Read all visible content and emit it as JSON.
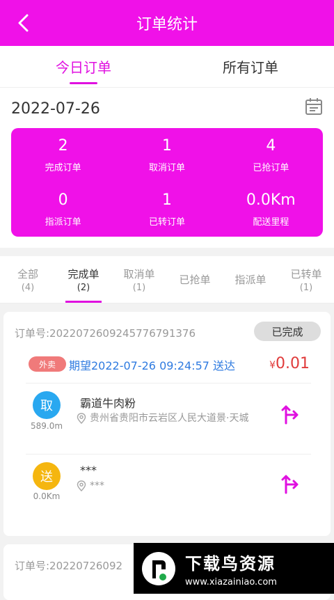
{
  "header": {
    "title": "订单统计"
  },
  "tabs": [
    {
      "label": "今日订单"
    },
    {
      "label": "所有订单"
    }
  ],
  "date": "2022-07-26",
  "stats": [
    {
      "value": "2",
      "label": "完成订单"
    },
    {
      "value": "1",
      "label": "取消订单"
    },
    {
      "value": "4",
      "label": "已抢订单"
    },
    {
      "value": "0",
      "label": "指派订单"
    },
    {
      "value": "1",
      "label": "已转订单"
    },
    {
      "value": "0.0Km",
      "label": "配送里程"
    }
  ],
  "filters": [
    {
      "label": "全部",
      "count": "(4)"
    },
    {
      "label": "完成单",
      "count": "(2)"
    },
    {
      "label": "取消单",
      "count": "(1)"
    },
    {
      "label": "已抢单",
      "count": ""
    },
    {
      "label": "指派单",
      "count": ""
    },
    {
      "label": "已转单",
      "count": "(1)"
    }
  ],
  "order": {
    "number": "订单号:20220726092457767913​76",
    "status": "已完成",
    "tag": "外卖",
    "expect": "期望2022-07-26 09:24:57 送达",
    "price_symbol": "¥",
    "price": "0.01",
    "pickup": {
      "badge": "取",
      "distance": "589.0m",
      "name": "霸道牛肉粉",
      "address": "贵州省贵阳市云岩区人民大道景·天城"
    },
    "deliver": {
      "badge": "送",
      "distance": "0.0Km",
      "name": "***",
      "address": "***"
    }
  },
  "order2": {
    "number": "订单号:20220726092"
  },
  "watermark": {
    "title": "下载鸟资源",
    "url": "www.xiazainiao.com"
  },
  "colors": {
    "brand": "#f011e8",
    "pickup": "#29a8f0",
    "deliver": "#f5b60f",
    "price": "#e03b3b",
    "link": "#2f7be0"
  }
}
